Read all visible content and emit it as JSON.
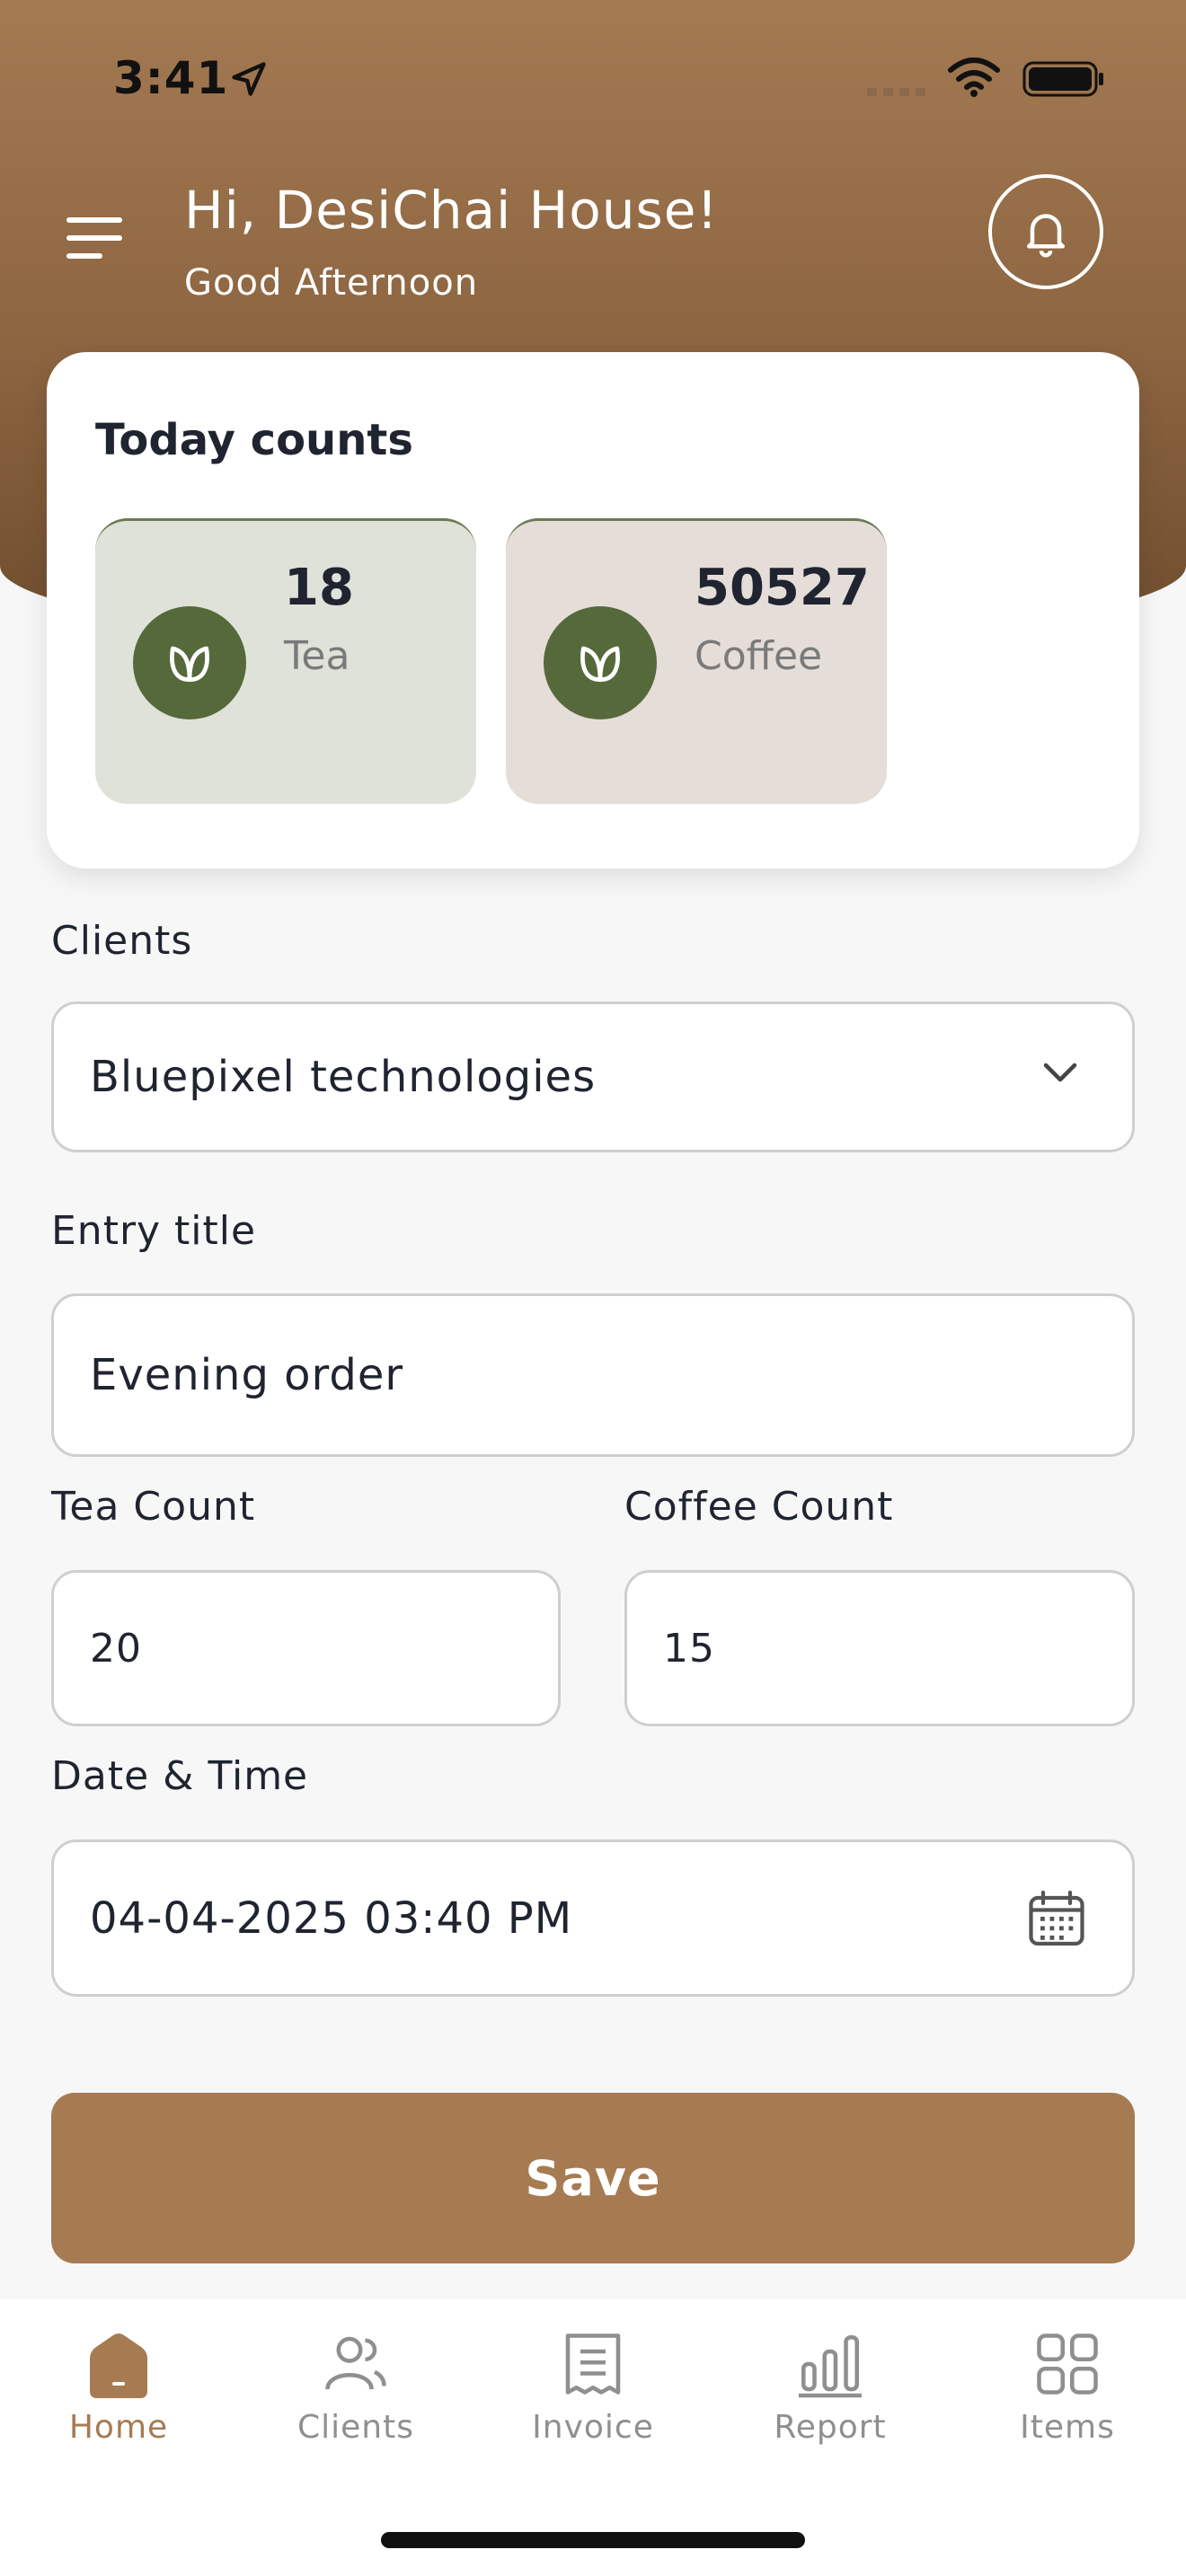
{
  "status_bar": {
    "time": "3:41"
  },
  "header": {
    "greeting": "Hi, DesiChai House!",
    "subgreeting": "Good Afternoon"
  },
  "counts": {
    "title": "Today counts",
    "items": [
      {
        "value": "18",
        "label": "Tea",
        "icon": "leaf-icon"
      },
      {
        "value": "50527",
        "label": "Coffee",
        "icon": "leaf-icon"
      }
    ]
  },
  "form": {
    "clients_label": "Clients",
    "clients_value": "Bluepixel technologies",
    "entry_title_label": "Entry title",
    "entry_title_value": "Evening order",
    "tea_count_label": "Tea Count",
    "tea_count_value": "20",
    "coffee_count_label": "Coffee Count",
    "coffee_count_value": "15",
    "datetime_label": "Date & Time",
    "datetime_value": "04-04-2025 03:40 PM",
    "save_label": "Save"
  },
  "nav": {
    "items": [
      {
        "label": "Home",
        "icon": "home-icon",
        "active": true
      },
      {
        "label": "Clients",
        "icon": "users-icon",
        "active": false
      },
      {
        "label": "Invoice",
        "icon": "invoice-icon",
        "active": false
      },
      {
        "label": "Report",
        "icon": "bar-chart-icon",
        "active": false
      },
      {
        "label": "Items",
        "icon": "grid-icon",
        "active": false
      }
    ]
  },
  "colors": {
    "header_brown": "#8c6440",
    "accent": "#a67b52",
    "leaf_green": "#55693a",
    "tea_tile": "#dfe2d8",
    "coffee_tile": "#e5ddd8"
  }
}
